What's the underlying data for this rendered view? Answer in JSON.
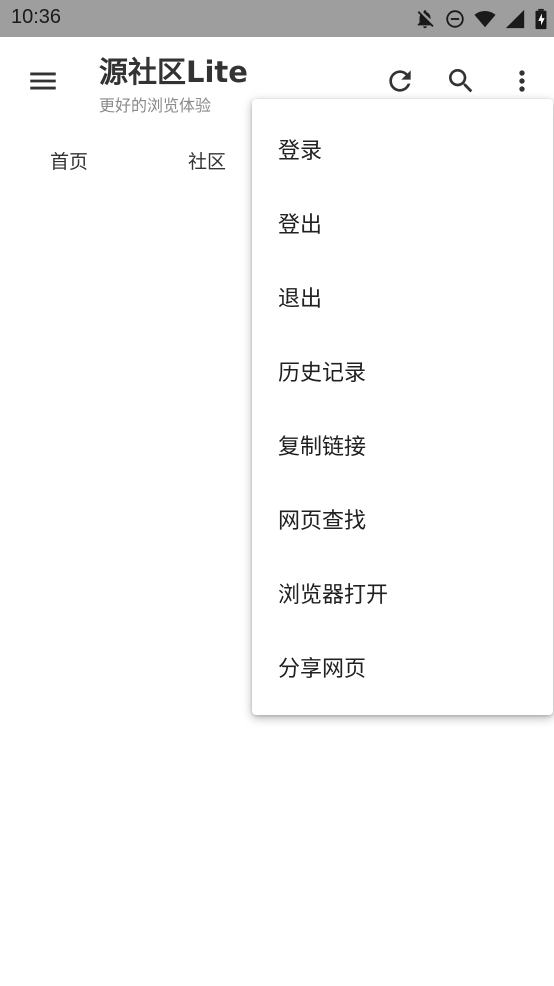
{
  "status_bar": {
    "time": "10:36",
    "icons": [
      "notifications-off-icon",
      "do-not-disturb-icon",
      "wifi-icon",
      "signal-icon",
      "battery-charging-icon"
    ]
  },
  "app_bar": {
    "title": "源社区Lite",
    "subtitle": "更好的浏览体验",
    "actions": [
      "menu-icon",
      "refresh-icon",
      "search-icon",
      "more-vert-icon"
    ]
  },
  "tabs": [
    {
      "label": "首页"
    },
    {
      "label": "社区"
    }
  ],
  "overflow_menu": {
    "items": [
      {
        "label": "登录"
      },
      {
        "label": "登出"
      },
      {
        "label": "退出"
      },
      {
        "label": "历史记录"
      },
      {
        "label": "复制链接"
      },
      {
        "label": "网页查找"
      },
      {
        "label": "浏览器打开"
      },
      {
        "label": "分享网页"
      }
    ]
  },
  "colors": {
    "status_bar": "#9e9e9e",
    "icon": "#333333",
    "text": "#212121",
    "subtitle": "#8a8a8a"
  }
}
